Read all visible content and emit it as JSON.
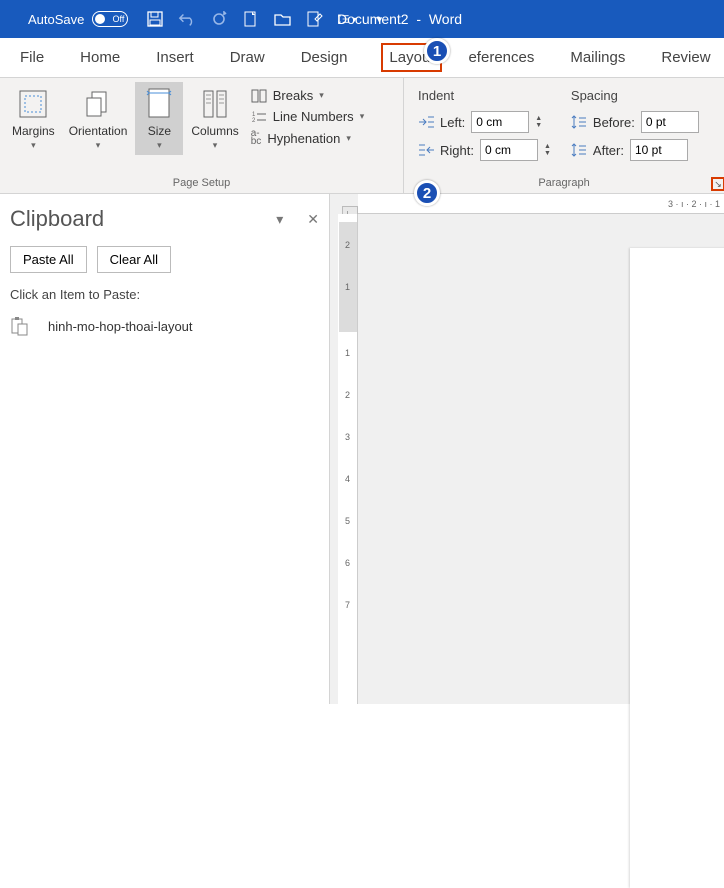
{
  "titlebar": {
    "autosave_label": "AutoSave",
    "autosave_state": "Off",
    "document": "Document2",
    "app": "Word"
  },
  "tabs": {
    "file": "File",
    "home": "Home",
    "insert": "Insert",
    "draw": "Draw",
    "design": "Design",
    "layout": "Layout",
    "references": "eferences",
    "mailings": "Mailings",
    "review": "Review"
  },
  "ribbon": {
    "page_setup": {
      "margins": "Margins",
      "orientation": "Orientation",
      "size": "Size",
      "columns": "Columns",
      "breaks": "Breaks",
      "line_numbers": "Line Numbers",
      "hyphenation": "Hyphenation",
      "group_label": "Page Setup"
    },
    "paragraph": {
      "indent_header": "Indent",
      "spacing_header": "Spacing",
      "left_label": "Left:",
      "right_label": "Right:",
      "before_label": "Before:",
      "after_label": "After:",
      "left_value": "0 cm",
      "right_value": "0 cm",
      "before_value": "0 pt",
      "after_value": "10 pt",
      "group_label": "Paragraph"
    }
  },
  "callouts": {
    "one": "1",
    "two": "2"
  },
  "clipboard": {
    "title": "Clipboard",
    "paste_all": "Paste All",
    "clear_all": "Clear All",
    "hint": "Click an Item to Paste:",
    "item1": "hinh-mo-hop-thoai-layout"
  },
  "ruler": {
    "h_marks": "3 · ı · 2 · ı · 1",
    "v_marks": [
      "2",
      "1",
      "1",
      "2",
      "3",
      "4",
      "5",
      "6",
      "7"
    ]
  }
}
